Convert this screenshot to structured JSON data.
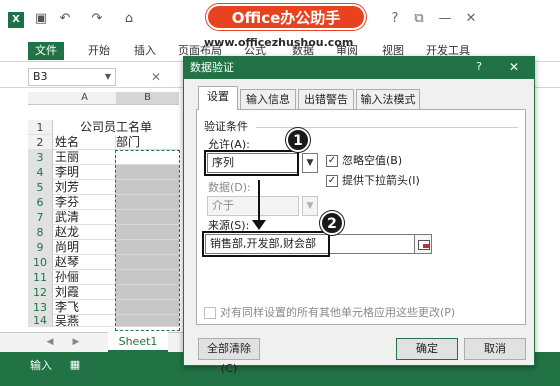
{
  "watermark": {
    "brand": "Office办公助手",
    "url": "www.officezhushou.com"
  },
  "titlebar": {
    "app_logo": "X",
    "window_buttons": [
      "?",
      "⧉",
      "—",
      "✕"
    ]
  },
  "ribbon": {
    "file_tab": "文件",
    "tabs": [
      "开始",
      "插入",
      "页面布局",
      "公式",
      "数据",
      "审阅",
      "视图",
      "开发工具"
    ]
  },
  "formula_bar": {
    "name_box": "B3",
    "cancel_symbol": "✕"
  },
  "sheet": {
    "columns": [
      "A",
      "B"
    ],
    "title": "公司员工名单",
    "row_numbers": [
      "1",
      "2",
      "3",
      "4",
      "5",
      "6",
      "7",
      "8",
      "9",
      "10",
      "11",
      "12",
      "13",
      "14"
    ],
    "header_name": "姓名",
    "header_dept": "部门",
    "names": [
      "王丽",
      "李明",
      "刘芳",
      "李芬",
      "武清",
      "赵龙",
      "尚明",
      "赵琴",
      "孙俪",
      "刘霞",
      "李飞",
      "吴燕"
    ],
    "tab_name": "Sheet1"
  },
  "statusbar": {
    "mode": "输入"
  },
  "dialog": {
    "title": "数据验证",
    "help": "?",
    "close": "✕",
    "tabs": [
      "设置",
      "输入信息",
      "出错警告",
      "输入法模式"
    ],
    "section_label": "验证条件",
    "allow_label": "允许(A):",
    "allow_value": "序列",
    "ignore_blank": "忽略空值(B)",
    "in_cell_dropdown": "提供下拉箭头(I)",
    "data_label": "数据(D):",
    "data_value": "介于",
    "source_label": "来源(S):",
    "source_value": "销售部,开发部,财会部",
    "apply_all": "对有同样设置的所有其他单元格应用这些更改(P)",
    "clear_all": "全部清除(C)",
    "ok": "确定",
    "cancel": "取消",
    "markers": [
      "1",
      "2"
    ]
  }
}
